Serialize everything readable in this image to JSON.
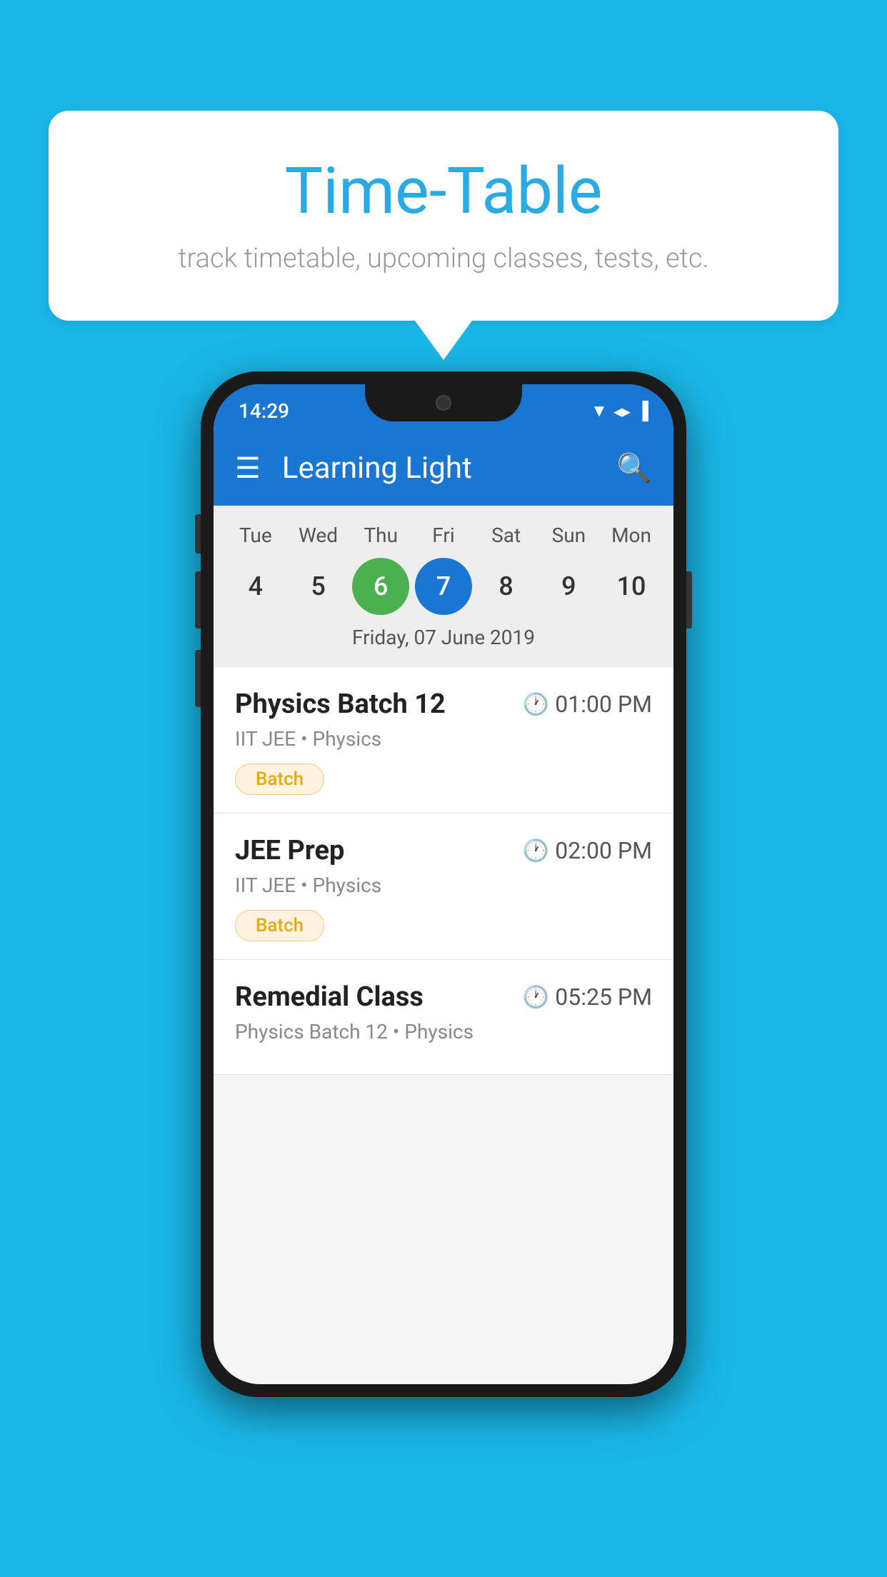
{
  "background_color": "#1ab8e8",
  "speech_bubble": {
    "title": "Time-Table",
    "subtitle": "track timetable, upcoming classes, tests, etc."
  },
  "phone": {
    "status_bar": {
      "time": "14:29",
      "icons": [
        "▼",
        "◂▸",
        "▐"
      ]
    },
    "app_bar": {
      "title": "Learning Light",
      "menu_icon": "☰",
      "search_icon": "🔍"
    },
    "calendar": {
      "days": [
        "Tue",
        "Wed",
        "Thu",
        "Fri",
        "Sat",
        "Sun",
        "Mon"
      ],
      "dates": [
        "4",
        "5",
        "6",
        "7",
        "8",
        "9",
        "10"
      ],
      "today_index": 2,
      "selected_index": 3,
      "selected_date_label": "Friday, 07 June 2019"
    },
    "schedule": [
      {
        "title": "Physics Batch 12",
        "time": "01:00 PM",
        "subtitle": "IIT JEE • Physics",
        "badge": "Batch"
      },
      {
        "title": "JEE Prep",
        "time": "02:00 PM",
        "subtitle": "IIT JEE • Physics",
        "badge": "Batch"
      },
      {
        "title": "Remedial Class",
        "time": "05:25 PM",
        "subtitle": "Physics Batch 12 • Physics",
        "badge": ""
      }
    ]
  }
}
